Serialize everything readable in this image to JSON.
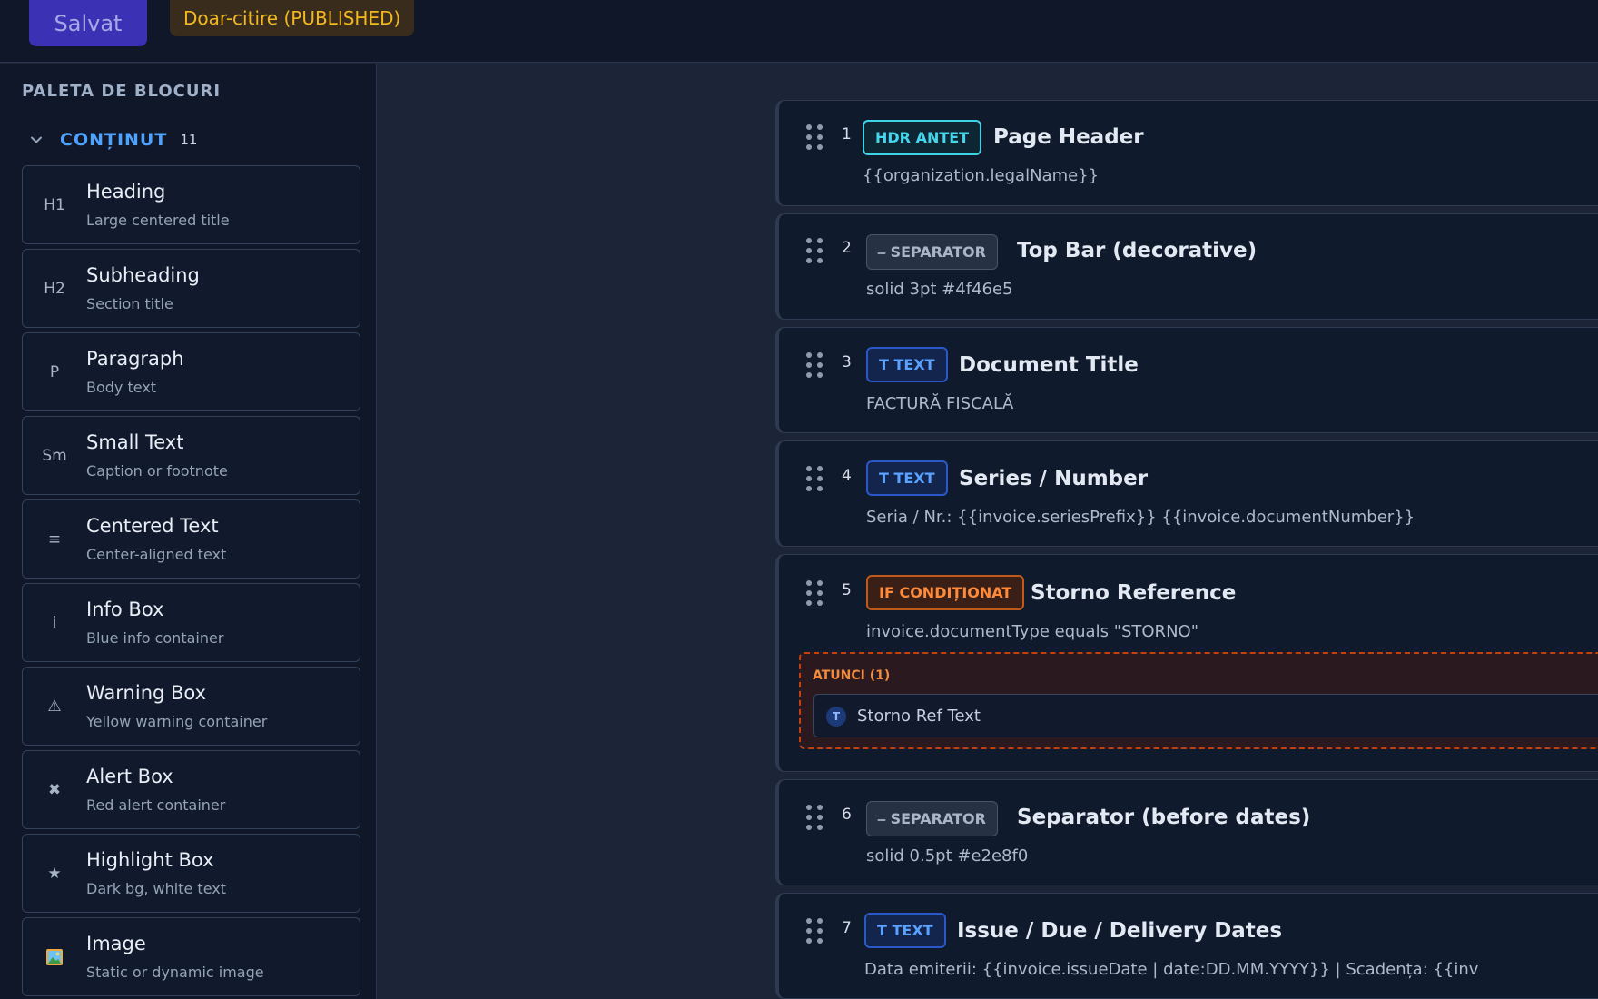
{
  "toolbar": {
    "save_label": "Salvat",
    "status_label": "Doar-citire (PUBLISHED)"
  },
  "sidebar": {
    "title": "PALETA DE BLOCURI",
    "category": {
      "label": "CONȚINUT",
      "count": "11",
      "icon": "chevron-down-icon"
    },
    "blocks": [
      {
        "icon": "H1",
        "title": "Heading",
        "desc": "Large centered title"
      },
      {
        "icon": "H2",
        "title": "Subheading",
        "desc": "Section title"
      },
      {
        "icon": "P",
        "title": "Paragraph",
        "desc": "Body text"
      },
      {
        "icon": "Sm",
        "title": "Small Text",
        "desc": "Caption or footnote"
      },
      {
        "icon": "≡",
        "title": "Centered Text",
        "desc": "Center-aligned text"
      },
      {
        "icon": "i",
        "title": "Info Box",
        "desc": "Blue info container"
      },
      {
        "icon": "⚠",
        "title": "Warning Box",
        "desc": "Yellow warning container"
      },
      {
        "icon": "✖",
        "title": "Alert Box",
        "desc": "Red alert container"
      },
      {
        "icon": "★",
        "title": "Highlight Box",
        "desc": "Dark bg, white text"
      },
      {
        "icon": "🖼",
        "title": "Image",
        "desc": "Static or dynamic image"
      }
    ]
  },
  "canvas": {
    "cards": [
      {
        "num": "1",
        "tag": "HDR ANTET",
        "title": "Page Header",
        "sub": "{{organization.legalName}}"
      },
      {
        "num": "2",
        "tag": "⎯ SEPARATOR",
        "title": "Top Bar (decorative)",
        "sub": "solid 3pt #4f46e5"
      },
      {
        "num": "3",
        "tag": "T TEXT",
        "title": "Document Title",
        "sub": "FACTURĂ FISCALĂ"
      },
      {
        "num": "4",
        "tag": "T TEXT",
        "title": "Series / Number",
        "sub": "Seria / Nr.: {{invoice.seriesPrefix}} {{invoice.documentNumber}}"
      },
      {
        "num": "5",
        "tag": "IF CONDIȚIONAT",
        "title": "Storno Reference",
        "sub": "invoice.documentType equals \"STORNO\"",
        "then_label": "ATUNCI (1)",
        "then_icon": "T",
        "then_item": "Storno Ref Text"
      },
      {
        "num": "6",
        "tag": "⎯ SEPARATOR",
        "title": "Separator (before dates)",
        "sub": "solid 0.5pt #e2e8f0"
      },
      {
        "num": "7",
        "tag": "T TEXT",
        "title": "Issue / Due / Delivery Dates",
        "sub": "Data emiterii: {{invoice.issueDate | date:DD.MM.YYYY}} | Scadența: {{inv"
      }
    ]
  }
}
